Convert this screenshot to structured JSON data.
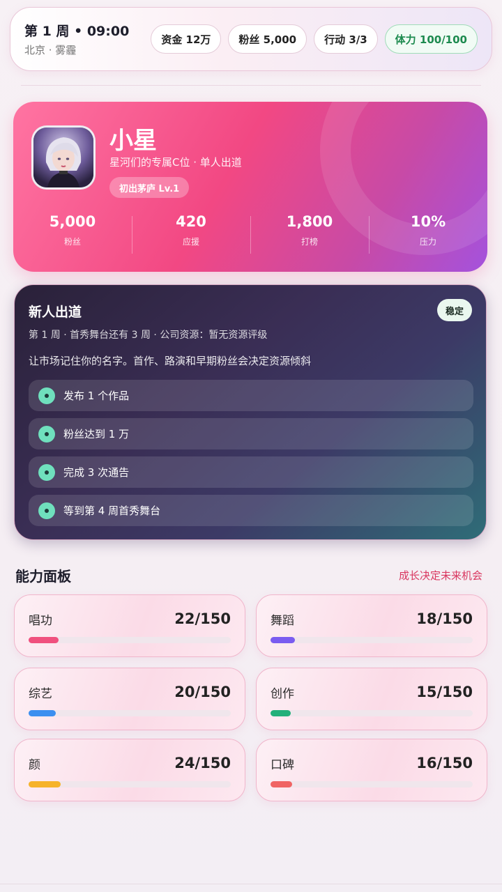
{
  "status": {
    "week_time": "第 1 周 • 09:00",
    "location": "北京 · 雾霾",
    "chips": [
      {
        "label": "资金 12万"
      },
      {
        "label": "粉丝 5,000"
      },
      {
        "label": "行动 3/3"
      },
      {
        "label": "体力 100/100"
      }
    ]
  },
  "profile": {
    "name": "小星",
    "subtitle": "星河们的专属C位 · 单人出道",
    "badge": "初出茅庐 Lv.1",
    "stats": [
      {
        "value": "5,000",
        "label": "粉丝"
      },
      {
        "value": "420",
        "label": "应援"
      },
      {
        "value": "1,800",
        "label": "打榜"
      },
      {
        "value": "10%",
        "label": "压力"
      }
    ]
  },
  "debut": {
    "title": "新人出道",
    "tag": "稳定",
    "info": "第 1 周 · 首秀舞台还有 3 周 · 公司资源：暂无资源评级",
    "description": "让市场记住你的名字。首作、路演和早期粉丝会决定资源倾斜",
    "tasks": [
      {
        "label": "发布 1 个作品"
      },
      {
        "label": "粉丝达到 1 万"
      },
      {
        "label": "完成 3 次通告"
      },
      {
        "label": "等到第 4 周首秀舞台"
      }
    ]
  },
  "abilities": {
    "title": "能力面板",
    "hint": "成长决定未来机会",
    "max": 150,
    "items": [
      {
        "name": "唱功",
        "value": 22,
        "display": "22/150",
        "color": "#f0507e"
      },
      {
        "name": "舞蹈",
        "value": 18,
        "display": "18/150",
        "color": "#7a5cf0"
      },
      {
        "name": "综艺",
        "value": 20,
        "display": "20/150",
        "color": "#3b8ff0"
      },
      {
        "name": "创作",
        "value": 15,
        "display": "15/150",
        "color": "#22b07a"
      },
      {
        "name": "颜",
        "value": 24,
        "display": "24/150",
        "color": "#f6b32a"
      },
      {
        "name": "口碑",
        "value": 16,
        "display": "16/150",
        "color": "#f06464"
      }
    ]
  }
}
